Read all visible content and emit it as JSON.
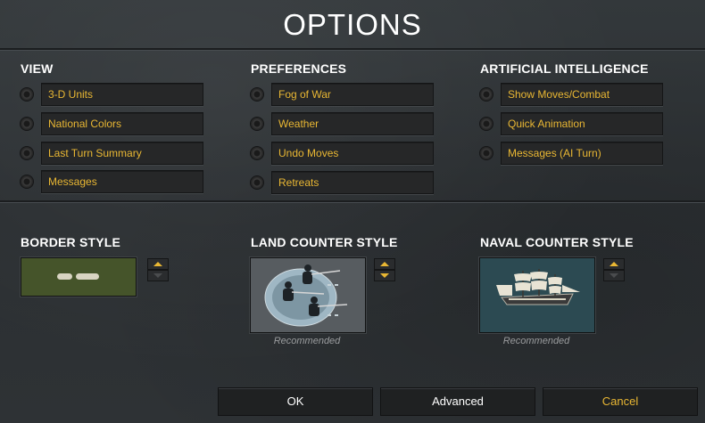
{
  "dialog": {
    "title": "OPTIONS"
  },
  "view": {
    "title": "VIEW",
    "items": [
      {
        "label": "3-D Units"
      },
      {
        "label": "National Colors"
      },
      {
        "label": "Last Turn Summary"
      },
      {
        "label": "Messages"
      }
    ]
  },
  "preferences": {
    "title": "PREFERENCES",
    "items": [
      {
        "label": "Fog of War"
      },
      {
        "label": "Weather"
      },
      {
        "label": "Undo Moves"
      },
      {
        "label": "Retreats"
      }
    ]
  },
  "ai": {
    "title": "ARTIFICIAL INTELLIGENCE",
    "items": [
      {
        "label": "Show Moves/Combat"
      },
      {
        "label": "Quick Animation"
      },
      {
        "label": "Messages (AI Turn)"
      }
    ]
  },
  "border_style": {
    "title": "BORDER STYLE"
  },
  "land_counter_style": {
    "title": "LAND COUNTER STYLE",
    "note": "Recommended"
  },
  "naval_counter_style": {
    "title": "NAVAL COUNTER STYLE",
    "note": "Recommended"
  },
  "buttons": {
    "ok": "OK",
    "advanced": "Advanced",
    "cancel": "Cancel"
  },
  "colors": {
    "accent": "#e9b733",
    "background": "#2d3134",
    "field": "#262728"
  }
}
